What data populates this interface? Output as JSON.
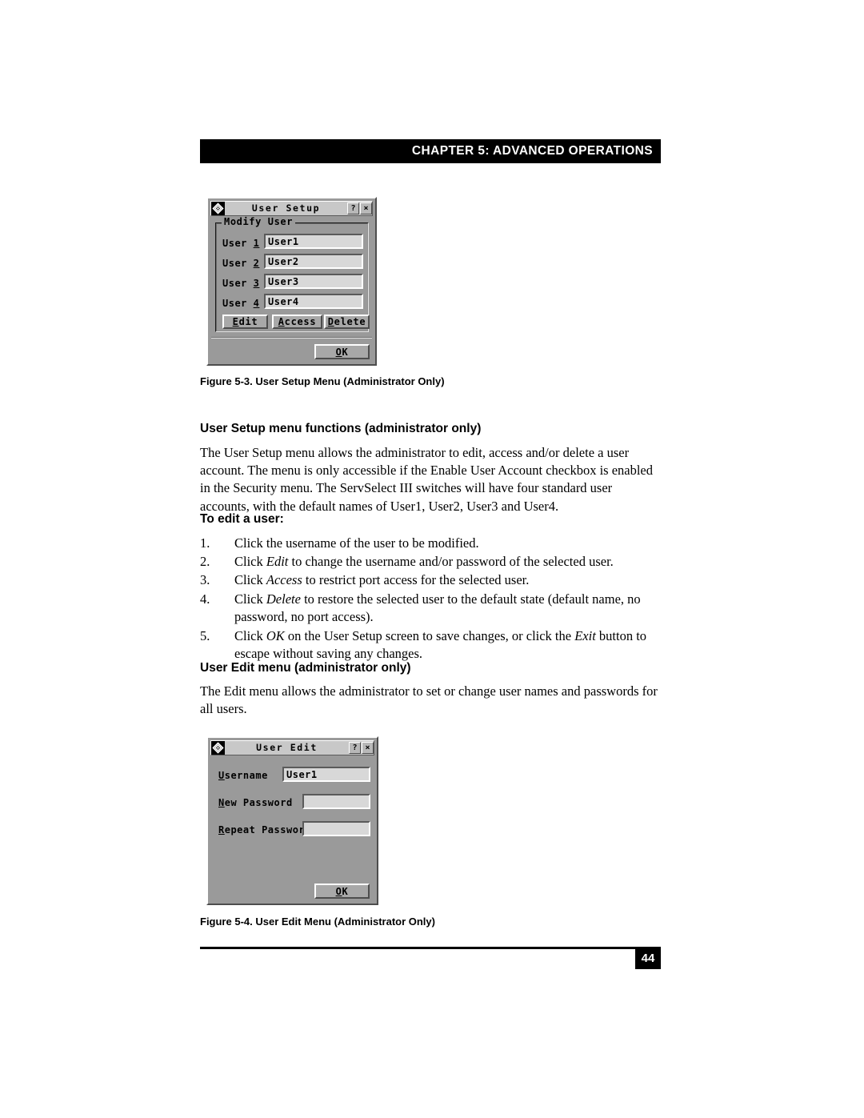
{
  "header": {
    "chapter_title": "CHAPTER 5: ADVANCED OPERATIONS"
  },
  "figure_user_setup": {
    "caption": "Figure 5-3.  User Setup Menu (Administrator Only)",
    "titlebar": {
      "title": "User Setup",
      "logo_icon": "diamond-logo-icon",
      "help_label": "?",
      "close_label": "×"
    },
    "groupbox_legend": "Modify User",
    "rows": [
      {
        "label_prefix": "User",
        "label_accel": "1",
        "value": "User1"
      },
      {
        "label_prefix": "User",
        "label_accel": "2",
        "value": "User2"
      },
      {
        "label_prefix": "User",
        "label_accel": "3",
        "value": "User3"
      },
      {
        "label_prefix": "User",
        "label_accel": "4",
        "value": "User4"
      }
    ],
    "buttons": {
      "edit_accel": "E",
      "edit_rest": "dit",
      "access_accel": "A",
      "access_rest": "ccess",
      "delete_accel": "D",
      "delete_rest": "elete",
      "ok_accel": "O",
      "ok_rest": "K"
    }
  },
  "section_user_setup": {
    "heading": "User Setup menu functions (administrator only)",
    "paragraph": "The User Setup menu allows the administrator to edit, access and/or delete a user account. The menu is only accessible if the Enable User Account checkbox is enabled in the Security menu. The ServSelect III switches will have four standard user accounts, with the default names of User1, User2, User3 and User4.",
    "subheading": "To edit a user:",
    "steps": [
      {
        "num": "1.",
        "pre": "Click the username of the user to be modified.",
        "italic": "",
        "post": ""
      },
      {
        "num": "2.",
        "pre": "Click ",
        "italic": "Edit",
        "post": " to change the username and/or password of the selected user."
      },
      {
        "num": "3.",
        "pre": "Click ",
        "italic": "Access",
        "post": " to restrict port access for the selected user."
      },
      {
        "num": "4.",
        "pre": "Click ",
        "italic": "Delete",
        "post": " to restore the selected user to the default state (default name, no password, no port access)."
      },
      {
        "num": "5.",
        "pre": "Click ",
        "italic": "OK",
        "post": " on the User Setup screen to save changes, or click the ",
        "italic2": "Exit",
        "post2": " button to escape without saving any changes."
      }
    ]
  },
  "section_user_edit": {
    "heading": "User Edit menu (administrator only)",
    "paragraph": "The Edit menu allows the administrator to set or change user names and passwords for all users."
  },
  "figure_user_edit": {
    "caption": "Figure 5-4.  User Edit Menu (Administrator Only)",
    "titlebar": {
      "title": "User Edit",
      "logo_icon": "diamond-logo-icon",
      "help_label": "?",
      "close_label": "×"
    },
    "fields": [
      {
        "label_accel": "U",
        "label_rest": "sername",
        "value": "User1"
      },
      {
        "label_accel": "N",
        "label_rest": "ew Password",
        "value": ""
      },
      {
        "label_accel": "R",
        "label_rest": "epeat Password",
        "value": ""
      }
    ],
    "buttons": {
      "ok_accel": "O",
      "ok_rest": "K"
    }
  },
  "footer": {
    "page_number": "44"
  },
  "colors": {
    "dialog_face": "#9a9a9a",
    "titlebar_face": "#c8c8c8",
    "field_face": "#d8d8d8",
    "ink": "#000000",
    "paper": "#ffffff"
  }
}
